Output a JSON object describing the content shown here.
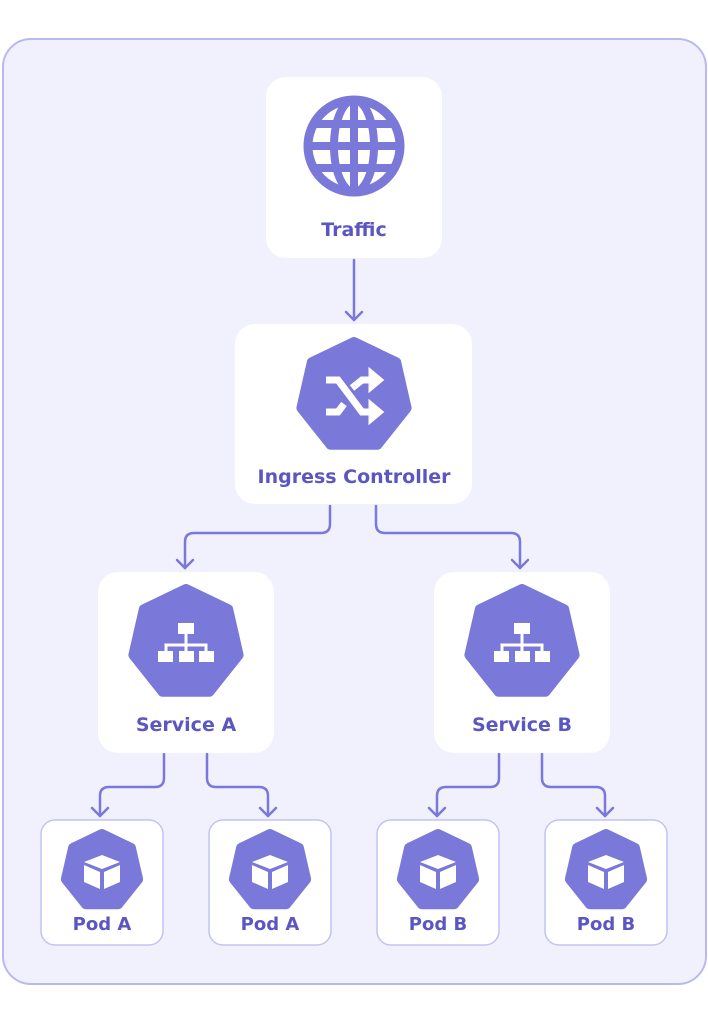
{
  "colors": {
    "panel_bg": "#f1f1fd",
    "panel_border": "#b9b8f1",
    "icon": "#7a78d8",
    "text": "#5b56c2",
    "connector": "#7a78d8"
  },
  "nodes": {
    "traffic": {
      "label": "Traffic",
      "icon": "globe-icon"
    },
    "ingress": {
      "label": "Ingress Controller",
      "icon": "shuffle-icon"
    },
    "service_a": {
      "label": "Service A",
      "icon": "sitemap-icon"
    },
    "service_b": {
      "label": "Service B",
      "icon": "sitemap-icon"
    },
    "pods": [
      {
        "label": "Pod A",
        "icon": "cube-icon"
      },
      {
        "label": "Pod A",
        "icon": "cube-icon"
      },
      {
        "label": "Pod B",
        "icon": "cube-icon"
      },
      {
        "label": "Pod B",
        "icon": "cube-icon"
      }
    ]
  },
  "edges": [
    [
      "Traffic",
      "Ingress Controller"
    ],
    [
      "Ingress Controller",
      "Service A"
    ],
    [
      "Ingress Controller",
      "Service B"
    ],
    [
      "Service A",
      "Pod A"
    ],
    [
      "Service A",
      "Pod A"
    ],
    [
      "Service B",
      "Pod B"
    ],
    [
      "Service B",
      "Pod B"
    ]
  ]
}
